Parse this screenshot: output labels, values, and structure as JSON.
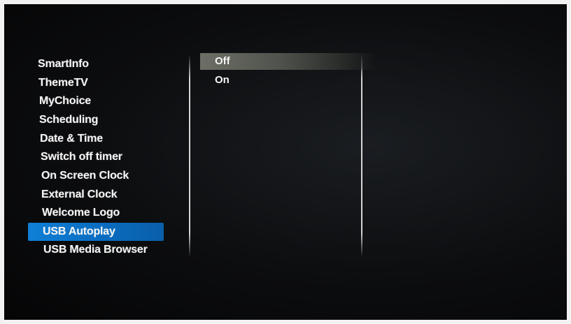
{
  "menu": {
    "items": [
      {
        "label": "SmartInfo"
      },
      {
        "label": "ThemeTV"
      },
      {
        "label": "MyChoice"
      },
      {
        "label": "Scheduling"
      },
      {
        "label": "Date & Time"
      },
      {
        "label": "Switch off timer"
      },
      {
        "label": "On Screen Clock"
      },
      {
        "label": "External Clock"
      },
      {
        "label": "Welcome Logo"
      },
      {
        "label": "USB Autoplay",
        "selected": true
      },
      {
        "label": "USB Media Browser"
      }
    ]
  },
  "options": {
    "items": [
      {
        "label": "Off",
        "selected": true
      },
      {
        "label": "On"
      }
    ]
  },
  "colors": {
    "selection_blue": "#0f7fd6",
    "option_highlight": "#6d6f66",
    "background": "#0c0d0f",
    "text": "#f4f4f4"
  }
}
